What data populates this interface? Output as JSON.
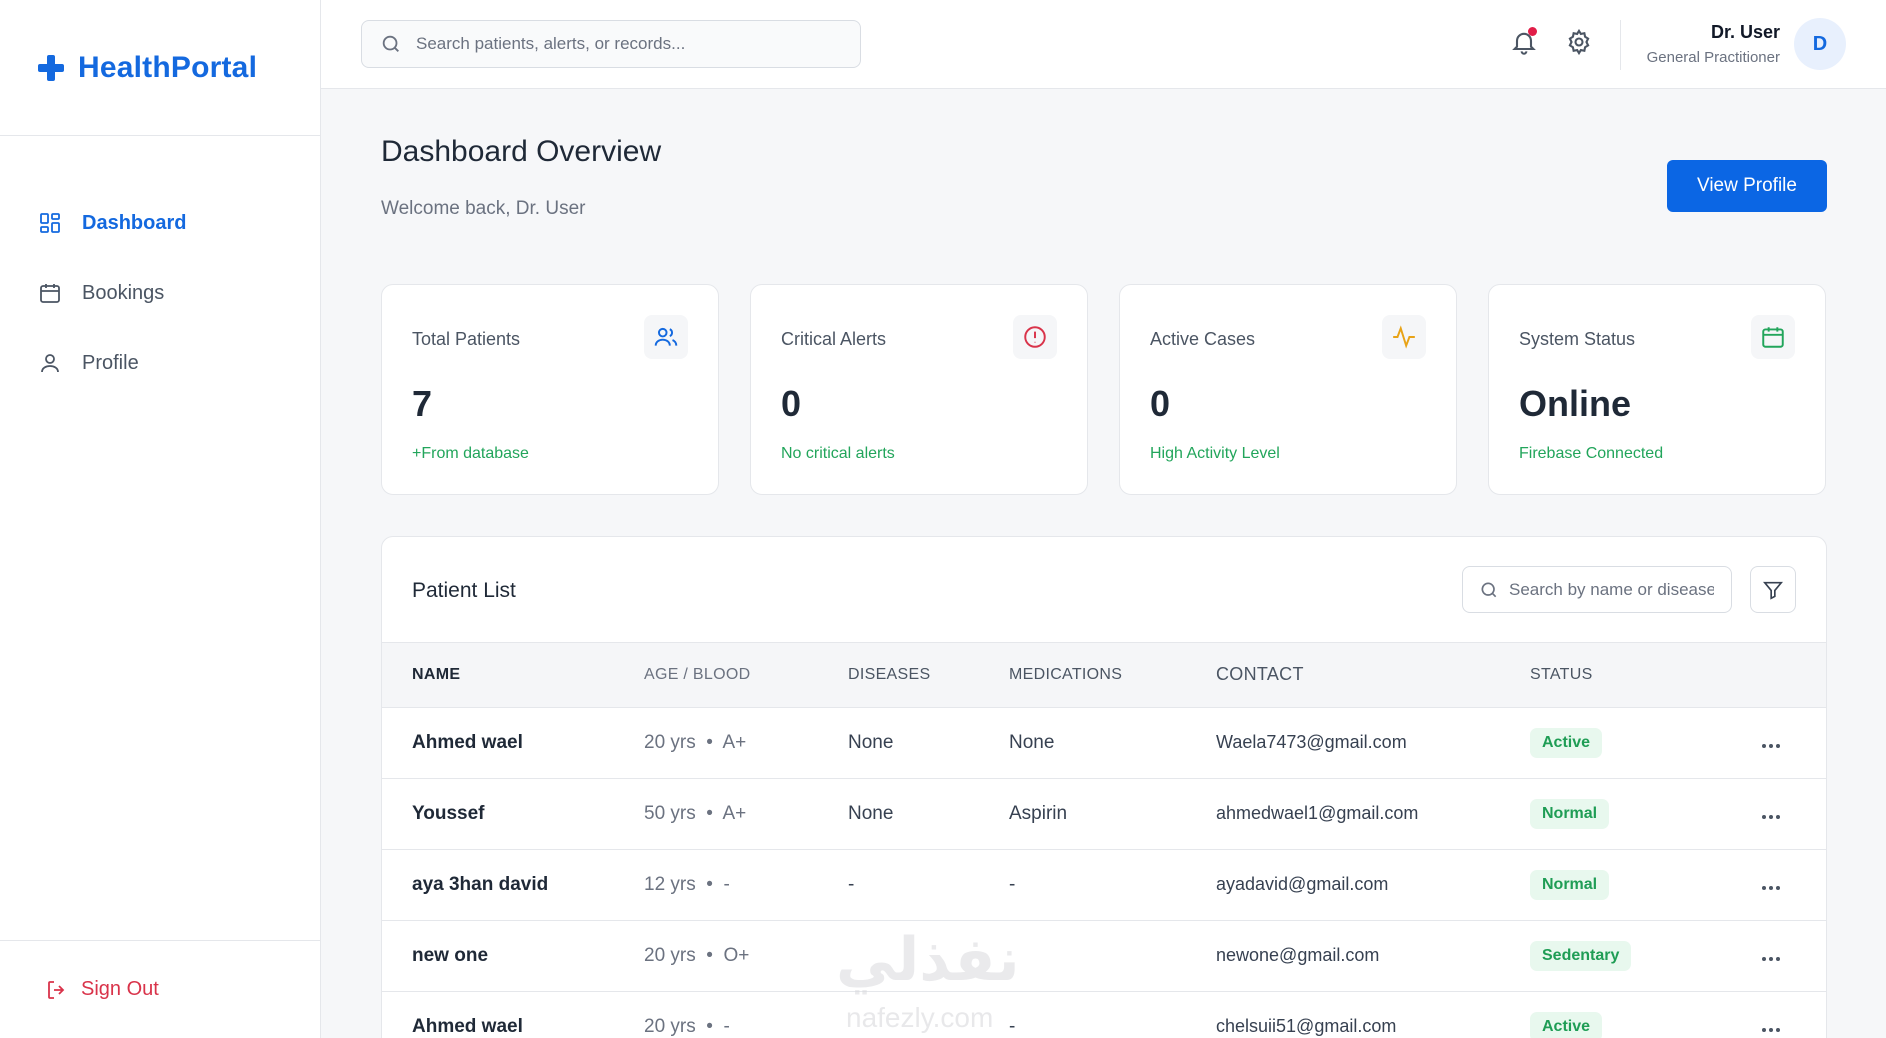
{
  "sidebar": {
    "brand": "HealthPortal",
    "items": [
      {
        "label": "Dashboard",
        "icon": "dashboard-grid-icon",
        "active": true
      },
      {
        "label": "Bookings",
        "icon": "calendar-icon",
        "active": false
      },
      {
        "label": "Profile",
        "icon": "user-icon",
        "active": false
      }
    ],
    "signout": "Sign Out"
  },
  "header": {
    "search_placeholder": "Search patients, alerts, or records...",
    "user_name": "Dr. User",
    "user_role": "General Practitioner",
    "avatar_initial": "D"
  },
  "main": {
    "title": "Dashboard Overview",
    "subtitle": "Welcome back, Dr. User",
    "view_profile": "View Profile",
    "cards": [
      {
        "label": "Total Patients",
        "value": "7",
        "note": "+From database",
        "icon": "users-icon",
        "icon_color": "#1469df"
      },
      {
        "label": "Critical Alerts",
        "value": "0",
        "note": "No critical alerts",
        "icon": "alert-circle-icon",
        "icon_color": "#d9334a"
      },
      {
        "label": "Active Cases",
        "value": "0",
        "note": "High Activity Level",
        "icon": "activity-icon",
        "icon_color": "#e8a317"
      },
      {
        "label": "System Status",
        "value": "Online",
        "note": "Firebase Connected",
        "icon": "calendar-icon",
        "icon_color": "#22a55b"
      }
    ]
  },
  "patients": {
    "title": "Patient List",
    "search_placeholder": "Search by name or disease",
    "columns": [
      "NAME",
      "AGE / BLOOD",
      "DISEASES",
      "MEDICATIONS",
      "CONTACT",
      "STATUS"
    ],
    "rows": [
      {
        "name": "Ahmed wael",
        "age": "20 yrs",
        "blood": "A+",
        "diseases": "None",
        "medications": "None",
        "contact": "Waela7473@gmail.com",
        "status": "Active"
      },
      {
        "name": "Youssef",
        "age": "50 yrs",
        "blood": "A+",
        "diseases": "None",
        "medications": "Aspirin",
        "contact": "ahmedwael1@gmail.com",
        "status": "Normal"
      },
      {
        "name": "aya 3han david",
        "age": "12 yrs",
        "blood": "-",
        "diseases": "-",
        "medications": "-",
        "contact": "ayadavid@gmail.com",
        "status": "Normal"
      },
      {
        "name": "new one",
        "age": "20 yrs",
        "blood": "O+",
        "diseases": "",
        "medications": "",
        "contact": "newone@gmail.com",
        "status": "Sedentary"
      },
      {
        "name": "Ahmed wael",
        "age": "20 yrs",
        "blood": "-",
        "diseases": "",
        "medications": "-",
        "contact": "chelsuii51@gmail.com",
        "status": "Active"
      }
    ]
  },
  "watermark": {
    "text": "نفذلي",
    "sub": "nafezly.com"
  }
}
